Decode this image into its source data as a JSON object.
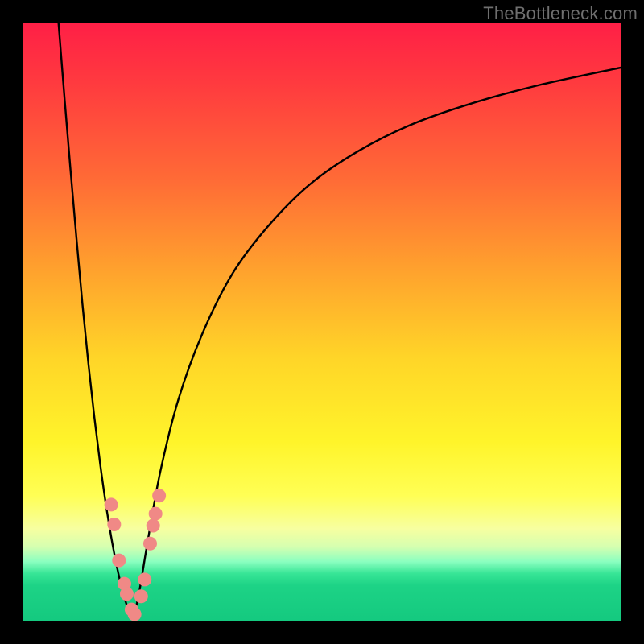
{
  "watermark": "TheBottleneck.com",
  "chart_data": {
    "type": "line",
    "title": "",
    "xlabel": "",
    "ylabel": "",
    "xlim": [
      0,
      100
    ],
    "ylim": [
      0,
      100
    ],
    "grid": false,
    "legend": false,
    "note": "Values estimated from pixel positions; no axis ticks or labels are rendered on the image.",
    "series": [
      {
        "name": "left-branch",
        "x": [
          6.0,
          7.0,
          8.0,
          9.0,
          10.0,
          11.0,
          12.0,
          13.0,
          14.0,
          15.0,
          16.0,
          17.0,
          18.0
        ],
        "y": [
          100.0,
          87.5,
          75.5,
          64.0,
          53.0,
          43.0,
          34.0,
          26.0,
          19.0,
          13.0,
          8.0,
          4.0,
          1.0
        ]
      },
      {
        "name": "right-branch",
        "x": [
          18.5,
          19.5,
          21.0,
          23.0,
          26.0,
          30.0,
          35.0,
          41.0,
          48.0,
          56.0,
          65.0,
          75.0,
          86.0,
          100.0
        ],
        "y": [
          0.5,
          5.0,
          14.0,
          25.0,
          37.0,
          48.0,
          58.0,
          66.0,
          73.0,
          78.5,
          83.0,
          86.5,
          89.5,
          92.5
        ]
      },
      {
        "name": "marker-dots",
        "type": "scatter",
        "x": [
          14.8,
          15.3,
          16.1,
          17.0,
          17.4,
          18.2,
          18.7,
          19.8,
          20.4,
          21.3,
          21.8,
          22.2,
          22.8
        ],
        "y": [
          19.5,
          16.2,
          10.2,
          6.3,
          4.6,
          2.0,
          1.2,
          4.2,
          7.0,
          13.0,
          16.0,
          18.0,
          21.0
        ]
      }
    ]
  },
  "colors": {
    "background": "#000000",
    "curve": "#000000",
    "markers": "#f08986"
  }
}
